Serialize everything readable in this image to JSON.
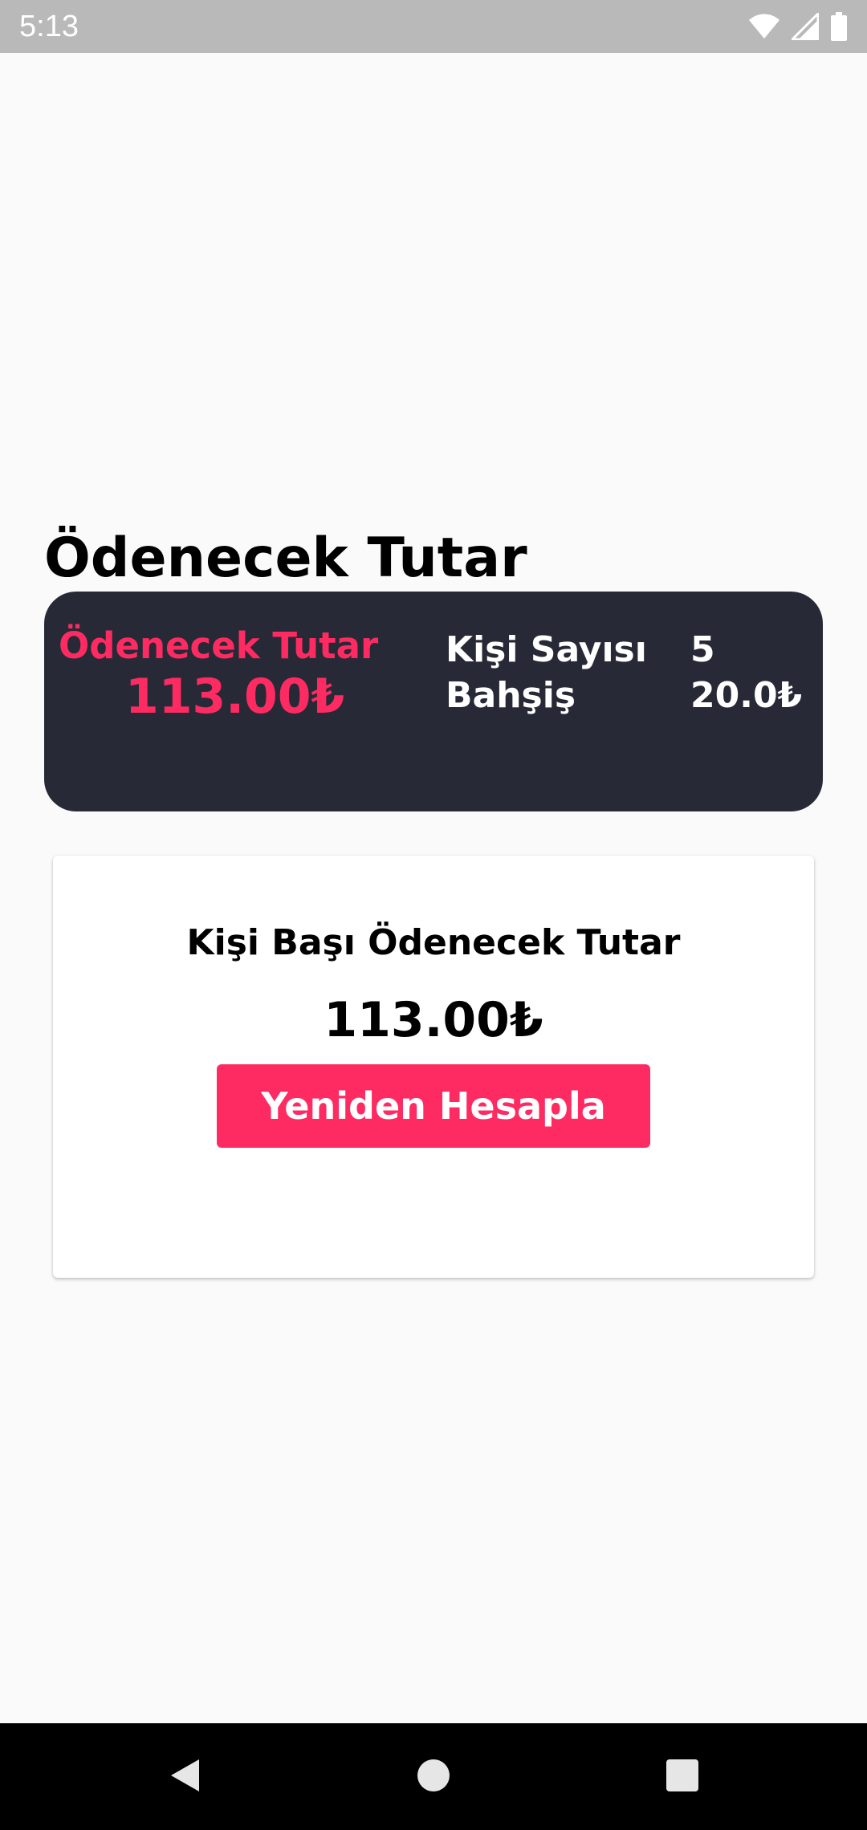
{
  "status_bar": {
    "time": "5:13",
    "icons": [
      "wifi-icon",
      "signal-icon",
      "battery-icon"
    ]
  },
  "page": {
    "title": "Ödenecek Tutar"
  },
  "summary": {
    "total_label": "Ödenecek Tutar",
    "total_value": "113.00₺",
    "people_label": "Kişi Sayısı",
    "people_value": "5",
    "tip_label": "Bahşiş",
    "tip_value": "20.0₺"
  },
  "result": {
    "label": "Kişi Başı Ödenecek Tutar",
    "value": "113.00₺",
    "button_label": "Yeniden Hesapla"
  },
  "nav_bar": {
    "icons": [
      "back-icon",
      "home-icon",
      "recents-icon"
    ]
  },
  "colors": {
    "accent": "#fe2b63",
    "card_dark": "#272a36",
    "background": "#fafafa",
    "status_bar": "#b9b9b9"
  }
}
